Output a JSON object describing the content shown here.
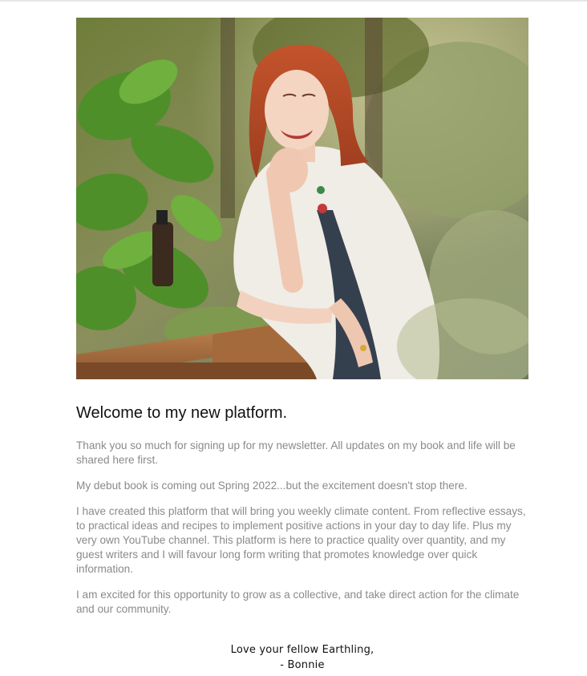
{
  "email": {
    "hero_image": {
      "alt": "Smiling woman with red hair leaning on a wooden garden planter"
    },
    "heading": "Welcome to my new platform.",
    "paragraphs": [
      "Thank you so much for signing up for my newsletter. All updates on my book and life will be shared here first.",
      "My debut book is coming out Spring 2022...but the excitement doesn't stop there.",
      "I have created this platform that will bring you weekly climate content. From reflective essays, to practical ideas and recipes to implement positive actions in your day to day life. Plus my very own YouTube channel. This platform is here to practice quality over quantity, and my guest writers and I will favour long form writing that promotes knowledge over quick information.",
      "I am excited for this opportunity to grow as a collective, and take direct action for the climate and our community."
    ],
    "signoff": {
      "line1": "Love your fellow Earthling,",
      "line2": "- Bonnie"
    }
  }
}
